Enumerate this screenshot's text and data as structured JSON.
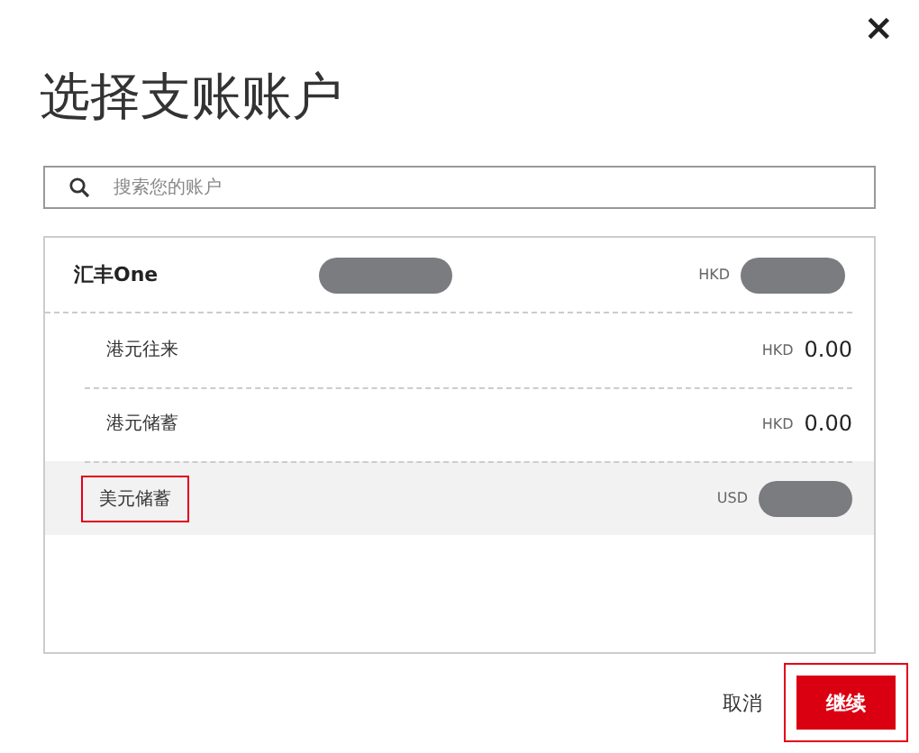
{
  "dialog": {
    "close": "×",
    "title": "选择支账账户"
  },
  "search": {
    "placeholder": "搜索您的账户"
  },
  "group": {
    "name": "汇丰One",
    "number_masked": true,
    "currency": "HKD",
    "balance_masked": true,
    "accounts": [
      {
        "name": "港元往来",
        "currency": "HKD",
        "balance": "0.00",
        "balance_masked": false,
        "selected": false,
        "highlighted": false
      },
      {
        "name": "港元储蓄",
        "currency": "HKD",
        "balance": "0.00",
        "balance_masked": false,
        "selected": false,
        "highlighted": false
      },
      {
        "name": "美元储蓄",
        "currency": "USD",
        "balance_masked": true,
        "selected": true,
        "highlighted": true
      }
    ]
  },
  "buttons": [
    {
      "label": "取消",
      "kind": "link",
      "highlighted": false
    },
    {
      "label": "继续",
      "kind": "primary",
      "highlighted": true
    }
  ]
}
